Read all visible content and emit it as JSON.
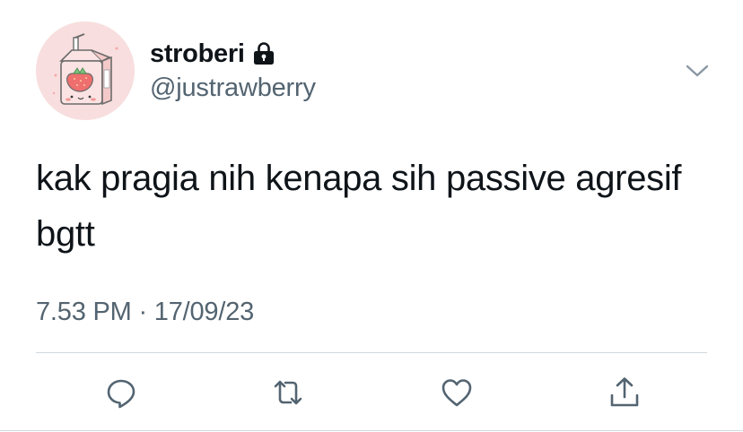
{
  "user": {
    "display_name": "stroberi",
    "handle": "@justrawberry",
    "protected": true,
    "avatar": "strawberry-milk-carton-avatar"
  },
  "tweet": {
    "text": "kak pragia nih kenapa sih passive agresif bgtt",
    "timestamp": "7.53 PM · 17/09/23"
  },
  "actions": [
    {
      "name": "reply",
      "icon": "comment-icon"
    },
    {
      "name": "retweet",
      "icon": "retweet-icon"
    },
    {
      "name": "like",
      "icon": "heart-icon"
    },
    {
      "name": "share",
      "icon": "share-icon"
    }
  ],
  "colors": {
    "text_primary": "#0f1419",
    "text_secondary": "#536471",
    "divider": "#cfd9de",
    "icon": "#536471",
    "avatar_bg": "#f8dede"
  }
}
